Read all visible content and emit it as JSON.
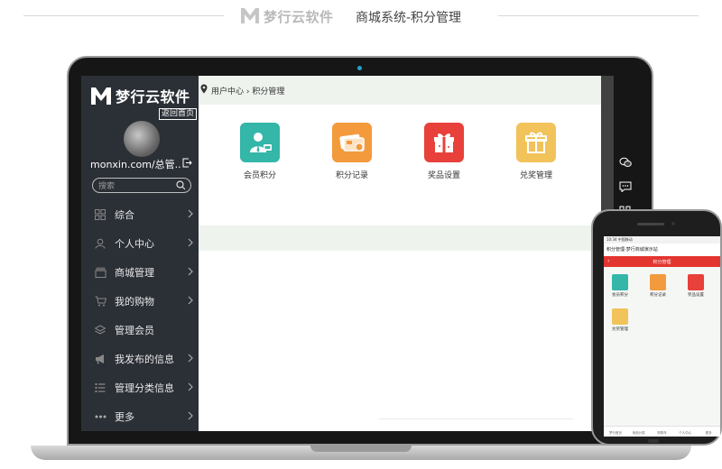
{
  "heading": {
    "brand": "梦行云软件",
    "subtitle": "商城系统-积分管理"
  },
  "sidebar": {
    "brand": "梦行云软件",
    "back_home": "返回首页",
    "user": "monxin.com/总管...",
    "search_placeholder": "搜索",
    "items": [
      {
        "label": "综合",
        "icon": "grid-icon"
      },
      {
        "label": "个人中心",
        "icon": "user-icon"
      },
      {
        "label": "商城管理",
        "icon": "shop-icon"
      },
      {
        "label": "我的购物",
        "icon": "cart-icon"
      },
      {
        "label": "管理会员",
        "icon": "layers-icon"
      },
      {
        "label": "我发布的信息",
        "icon": "megaphone-icon"
      },
      {
        "label": "管理分类信息",
        "icon": "list-icon"
      },
      {
        "label": "更多",
        "icon": "more-icon"
      }
    ]
  },
  "main": {
    "breadcrumb_home": "用户中心",
    "breadcrumb_sep": "›",
    "breadcrumb_current": "积分管理",
    "tiles": [
      {
        "label": "会员积分",
        "color": "#34b6a8"
      },
      {
        "label": "积分记录",
        "color": "#f39a3d"
      },
      {
        "label": "奖品设置",
        "color": "#e8403a"
      },
      {
        "label": "兑奖管理",
        "color": "#f2c35a"
      }
    ]
  },
  "phone": {
    "status": "10:34 中国移动",
    "title": "积分管理-梦行商城演示站",
    "header": "积分管理",
    "tiles": [
      {
        "label": "会员积分",
        "color": "#34b6a8"
      },
      {
        "label": "积分记录",
        "color": "#f39a3d"
      },
      {
        "label": "奖品设置",
        "color": "#e8403a"
      },
      {
        "label": "兑奖管理",
        "color": "#f2c35a"
      }
    ],
    "nav": [
      "梦行首页",
      "商品分类",
      "购物车",
      "个人中心",
      "更多"
    ]
  }
}
